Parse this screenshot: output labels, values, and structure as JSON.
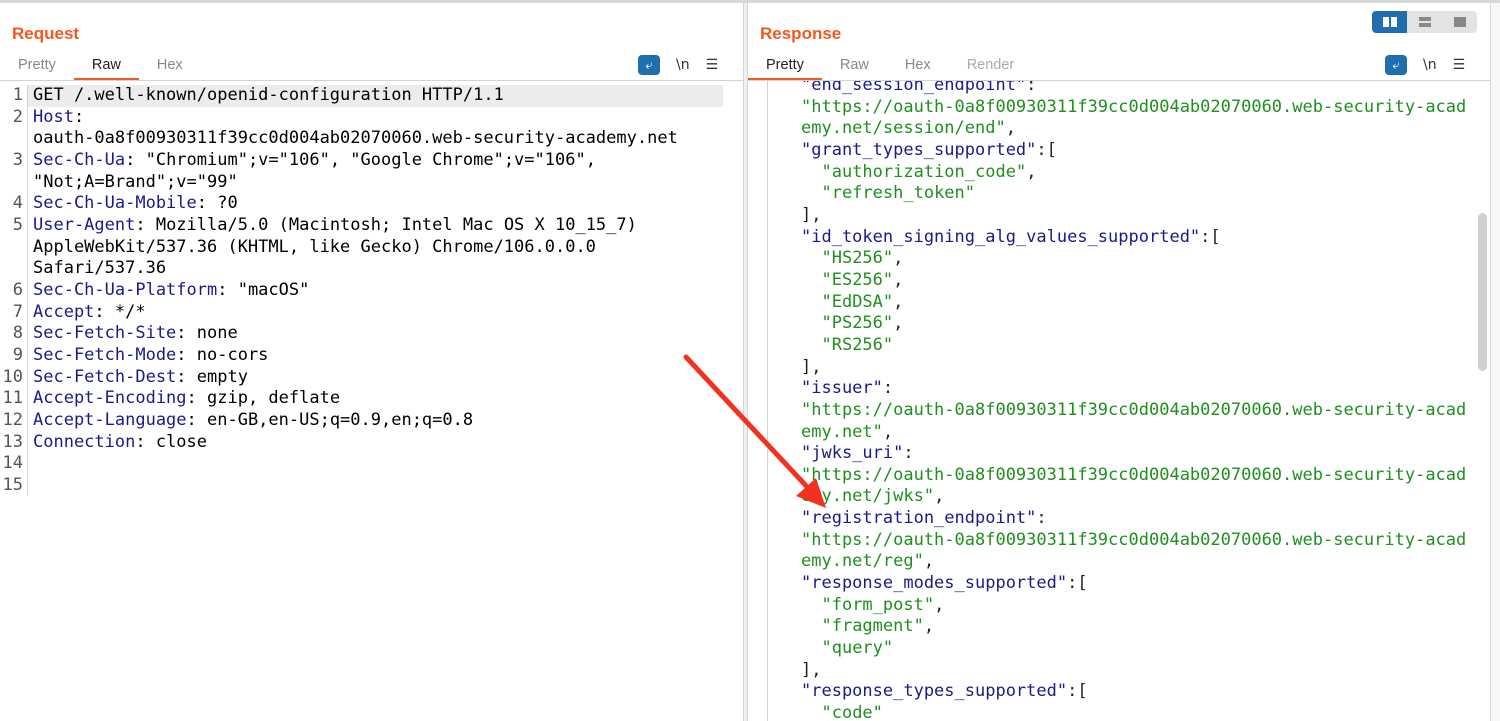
{
  "request": {
    "title": "Request",
    "tabs": [
      {
        "label": "Pretty"
      },
      {
        "label": "Raw"
      },
      {
        "label": "Hex"
      }
    ],
    "active_tab": "Raw",
    "tools": {
      "wrap_icon": "word-wrap-icon",
      "newline": "\\n",
      "menu": "☰"
    },
    "rows": [
      {
        "n": "1",
        "name": "",
        "text": "GET /.well-known/openid-configuration HTTP/1.1"
      },
      {
        "n": "2",
        "name": "Host",
        "text": ":"
      },
      {
        "n": "",
        "name": "",
        "text": "oauth-0a8f00930311f39cc0d004ab02070060.web-security-academy.net"
      },
      {
        "n": "3",
        "name": "Sec-Ch-Ua",
        "text": ": \"Chromium\";v=\"106\", \"Google Chrome\";v=\"106\","
      },
      {
        "n": "",
        "name": "",
        "text": "\"Not;A=Brand\";v=\"99\""
      },
      {
        "n": "4",
        "name": "Sec-Ch-Ua-Mobile",
        "text": ": ?0"
      },
      {
        "n": "5",
        "name": "User-Agent",
        "text": ": Mozilla/5.0 (Macintosh; Intel Mac OS X 10_15_7)"
      },
      {
        "n": "",
        "name": "",
        "text": "AppleWebKit/537.36 (KHTML, like Gecko) Chrome/106.0.0.0"
      },
      {
        "n": "",
        "name": "",
        "text": "Safari/537.36"
      },
      {
        "n": "6",
        "name": "Sec-Ch-Ua-Platform",
        "text": ": \"macOS\""
      },
      {
        "n": "7",
        "name": "Accept",
        "text": ": */*"
      },
      {
        "n": "8",
        "name": "Sec-Fetch-Site",
        "text": ": none"
      },
      {
        "n": "9",
        "name": "Sec-Fetch-Mode",
        "text": ": no-cors"
      },
      {
        "n": "10",
        "name": "Sec-Fetch-Dest",
        "text": ": empty"
      },
      {
        "n": "11",
        "name": "Accept-Encoding",
        "text": ": gzip, deflate"
      },
      {
        "n": "12",
        "name": "Accept-Language",
        "text": ": en-GB,en-US;q=0.9,en;q=0.8"
      },
      {
        "n": "13",
        "name": "Connection",
        "text": ": close"
      },
      {
        "n": "14",
        "name": "",
        "text": ""
      },
      {
        "n": "15",
        "name": "",
        "text": ""
      }
    ]
  },
  "response": {
    "title": "Response",
    "tabs": [
      {
        "label": "Pretty"
      },
      {
        "label": "Raw"
      },
      {
        "label": "Hex"
      },
      {
        "label": "Render"
      }
    ],
    "active_tab": "Pretty",
    "tools": {
      "wrap_icon": "word-wrap-icon",
      "newline": "\\n",
      "menu": "☰"
    },
    "layout_buttons": [
      "split-horizontal-icon",
      "split-vertical-icon",
      "single-pane-icon"
    ],
    "rows": [
      [
        [
          "k",
          "\"end_session_endpoint\""
        ],
        [
          "p",
          ":"
        ]
      ],
      [
        [
          "s",
          "\"https://oauth-0a8f00930311f39cc0d004ab02070060.web-security-acad"
        ]
      ],
      [
        [
          "s",
          "emy.net/session/end\""
        ],
        [
          "p",
          ","
        ]
      ],
      [
        [
          "k",
          "\"grant_types_supported\""
        ],
        [
          "p",
          ":["
        ]
      ],
      [
        [
          "p",
          "  "
        ],
        [
          "s",
          "\"authorization_code\""
        ],
        [
          "p",
          ","
        ]
      ],
      [
        [
          "p",
          "  "
        ],
        [
          "s",
          "\"refresh_token\""
        ]
      ],
      [
        [
          "p",
          "],"
        ]
      ],
      [
        [
          "k",
          "\"id_token_signing_alg_values_supported\""
        ],
        [
          "p",
          ":["
        ]
      ],
      [
        [
          "p",
          "  "
        ],
        [
          "s",
          "\"HS256\""
        ],
        [
          "p",
          ","
        ]
      ],
      [
        [
          "p",
          "  "
        ],
        [
          "s",
          "\"ES256\""
        ],
        [
          "p",
          ","
        ]
      ],
      [
        [
          "p",
          "  "
        ],
        [
          "s",
          "\"EdDSA\""
        ],
        [
          "p",
          ","
        ]
      ],
      [
        [
          "p",
          "  "
        ],
        [
          "s",
          "\"PS256\""
        ],
        [
          "p",
          ","
        ]
      ],
      [
        [
          "p",
          "  "
        ],
        [
          "s",
          "\"RS256\""
        ]
      ],
      [
        [
          "p",
          "],"
        ]
      ],
      [
        [
          "k",
          "\"issuer\""
        ],
        [
          "p",
          ":"
        ]
      ],
      [
        [
          "s",
          "\"https://oauth-0a8f00930311f39cc0d004ab02070060.web-security-acad"
        ]
      ],
      [
        [
          "s",
          "emy.net\""
        ],
        [
          "p",
          ","
        ]
      ],
      [
        [
          "k",
          "\"jwks_uri\""
        ],
        [
          "p",
          ":"
        ]
      ],
      [
        [
          "s",
          "\"https://oauth-0a8f00930311f39cc0d004ab02070060.web-security-acad"
        ]
      ],
      [
        [
          "s",
          "emy.net/jwks\""
        ],
        [
          "p",
          ","
        ]
      ],
      [
        [
          "k",
          "\"registration_endpoint\""
        ],
        [
          "p",
          ":"
        ]
      ],
      [
        [
          "s",
          "\"https://oauth-0a8f00930311f39cc0d004ab02070060.web-security-acad"
        ]
      ],
      [
        [
          "s",
          "emy.net/reg\""
        ],
        [
          "p",
          ","
        ]
      ],
      [
        [
          "k",
          "\"response_modes_supported\""
        ],
        [
          "p",
          ":["
        ]
      ],
      [
        [
          "p",
          "  "
        ],
        [
          "s",
          "\"form_post\""
        ],
        [
          "p",
          ","
        ]
      ],
      [
        [
          "p",
          "  "
        ],
        [
          "s",
          "\"fragment\""
        ],
        [
          "p",
          ","
        ]
      ],
      [
        [
          "p",
          "  "
        ],
        [
          "s",
          "\"query\""
        ]
      ],
      [
        [
          "p",
          "],"
        ]
      ],
      [
        [
          "k",
          "\"response_types_supported\""
        ],
        [
          "p",
          ":["
        ]
      ],
      [
        [
          "p",
          "  "
        ],
        [
          "s",
          "\"code\""
        ]
      ]
    ]
  },
  "annotation": {
    "arrow_color": "#f0321e",
    "arrow_target": "registration_endpoint"
  },
  "colors": {
    "accent": "#f5571f",
    "key": "#1a1a8a",
    "string": "#1f8f1f",
    "button": "#1f6fb0"
  }
}
